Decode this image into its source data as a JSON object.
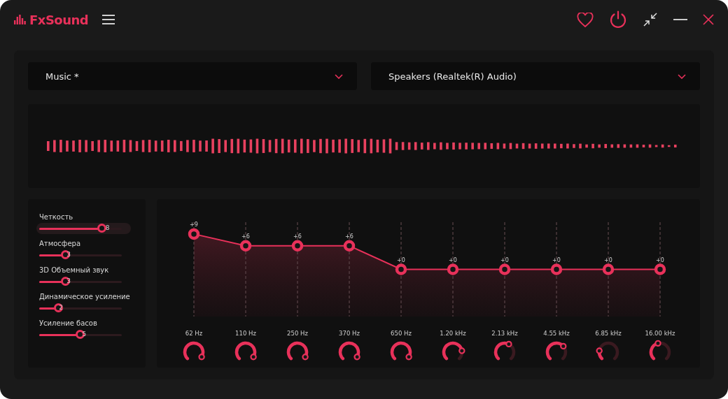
{
  "app": {
    "name": "FxSound"
  },
  "preset": {
    "value": "Music *"
  },
  "output": {
    "value": "Speakers (Realtek(R) Audio)"
  },
  "effects": [
    {
      "label": "Четкость",
      "value": "8",
      "level": 0.8,
      "focused": true
    },
    {
      "label": "Атмосфера",
      "value": "3",
      "level": 0.3,
      "focused": false
    },
    {
      "label": "3D Объемный звук",
      "value": "3",
      "level": 0.3,
      "focused": false
    },
    {
      "label": "Динамическое усиление",
      "value": "2",
      "level": 0.2,
      "focused": false
    },
    {
      "label": "Усиление басов",
      "value": "5",
      "level": 0.5,
      "focused": false
    }
  ],
  "bands": [
    {
      "gain": "+9",
      "level": 0.875,
      "frequency": "62 Hz"
    },
    {
      "gain": "+6",
      "level": 0.75,
      "frequency": "110 Hz"
    },
    {
      "gain": "+6",
      "level": 0.75,
      "frequency": "250 Hz"
    },
    {
      "gain": "+6",
      "level": 0.75,
      "frequency": "370 Hz"
    },
    {
      "gain": "+0",
      "level": 0.5,
      "frequency": "650 Hz"
    },
    {
      "gain": "+0",
      "level": 0.5,
      "frequency": "1.20 kHz"
    },
    {
      "gain": "+0",
      "level": 0.5,
      "frequency": "2.13 kHz"
    },
    {
      "gain": "+0",
      "level": 0.5,
      "frequency": "4.55 kHz"
    },
    {
      "gain": "+0",
      "level": 0.5,
      "frequency": "6.85 kHz"
    },
    {
      "gain": "+0",
      "level": 0.5,
      "frequency": "16.00 kHz"
    }
  ]
}
